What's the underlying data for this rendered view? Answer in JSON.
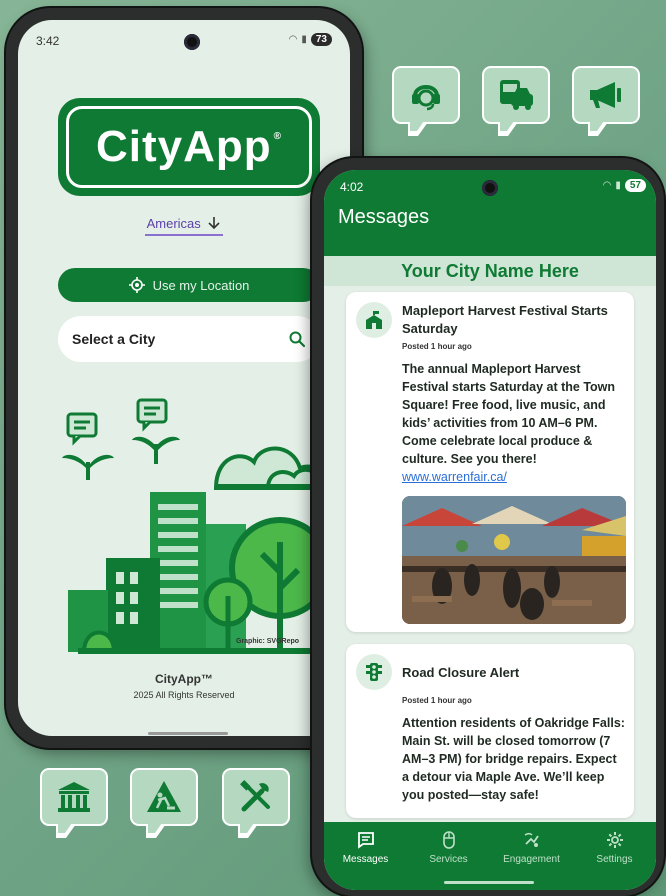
{
  "phone1": {
    "status_time": "3:42",
    "battery": "73",
    "logo_text": "CityApp",
    "logo_mark": "®",
    "region": "Americas",
    "location_button": "Use my Location",
    "city_select_placeholder": "Select a City",
    "graphic_credit": "Graphic: SVGRepo",
    "footer_name": "CityApp™",
    "footer_copyright": "2025 All Rights Reserved"
  },
  "bubbles": {
    "top": [
      "headset-icon",
      "transit-icon",
      "megaphone-icon"
    ],
    "bottom": [
      "government-building-icon",
      "construction-icon",
      "tools-icon"
    ]
  },
  "phone2": {
    "status_time": "4:02",
    "battery": "57",
    "title": "Messages",
    "city_banner": "Your City Name Here",
    "messages": [
      {
        "icon": "school-icon",
        "title": "Mapleport Harvest Festival Starts Saturday",
        "posted": "Posted 1 hour ago",
        "body": "The annual Mapleport Harvest Festival starts Saturday at the Town Square! Free food, live music, and kids’ activities from 10 AM–6 PM. Come celebrate local produce & culture. See you there!",
        "link": "www.warrenfair.ca/"
      },
      {
        "icon": "traffic-light-icon",
        "title": "Road Closure Alert",
        "posted": "Posted 1 hour ago",
        "body": "Attention residents of Oakridge Falls: Main St. will be closed tomorrow (7 AM–3 PM) for bridge repairs. Expect a detour via Maple Ave. We’ll keep you posted—stay safe!"
      }
    ],
    "nav": [
      {
        "label": "Messages",
        "active": true
      },
      {
        "label": "Services",
        "active": false
      },
      {
        "label": "Engagement",
        "active": false
      },
      {
        "label": "Settings",
        "active": false
      }
    ]
  },
  "colors": {
    "brand_green": "#0e7a33",
    "light_bg": "#e4f0e7",
    "bubble_fill": "#b5d9c0",
    "link_blue": "#2b6fd6"
  }
}
